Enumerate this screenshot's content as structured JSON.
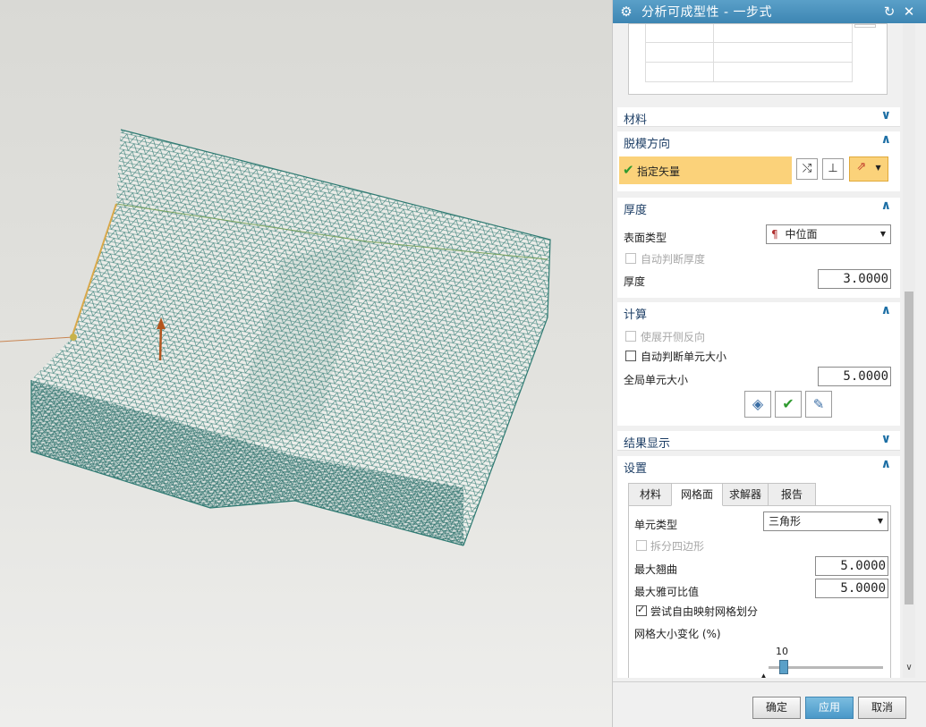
{
  "window": {
    "title": "分析可成型性 - 一步式"
  },
  "sections": {
    "material": {
      "label": "材料"
    },
    "draw_direction": {
      "label": "脱模方向",
      "vector_label": "指定矢量"
    },
    "thickness": {
      "label": "厚度",
      "surface_type_label": "表面类型",
      "surface_type_value": "中位面",
      "auto_thickness_label": "自动判断厚度",
      "thickness_label": "厚度",
      "thickness_value": "3.0000"
    },
    "compute": {
      "label": "计算",
      "flip_label": "使展开侧反向",
      "auto_size_label": "自动判断单元大小",
      "global_size_label": "全局单元大小",
      "global_size_value": "5.0000"
    },
    "results": {
      "label": "结果显示"
    },
    "settings": {
      "label": "设置",
      "tabs": [
        "材料",
        "网格面",
        "求解器",
        "报告"
      ],
      "element_type_label": "单元类型",
      "element_type_value": "三角形",
      "split_quad_label": "拆分四边形",
      "max_warp_label": "最大翘曲",
      "max_warp_value": "5.0000",
      "max_jacobian_label": "最大雅可比值",
      "max_jacobian_value": "5.0000",
      "free_mapping_label": "尝试自由映射网格划分",
      "mesh_variation_label": "网格大小变化 (%)",
      "mesh_variation_value": "10"
    }
  },
  "footer": {
    "ok": "确定",
    "apply": "应用",
    "cancel": "取消"
  },
  "icons": {
    "gear": "gear-icon",
    "reset": "reset-icon",
    "close": "close-icon",
    "chevron_down": "chevron-down-icon",
    "chevron_up": "chevron-up-icon"
  },
  "colors": {
    "title_bar": "#4a92bf",
    "vector_highlight": "#fbd27a",
    "mesh": "#3a7a74",
    "accent": "#1d6fa5"
  }
}
